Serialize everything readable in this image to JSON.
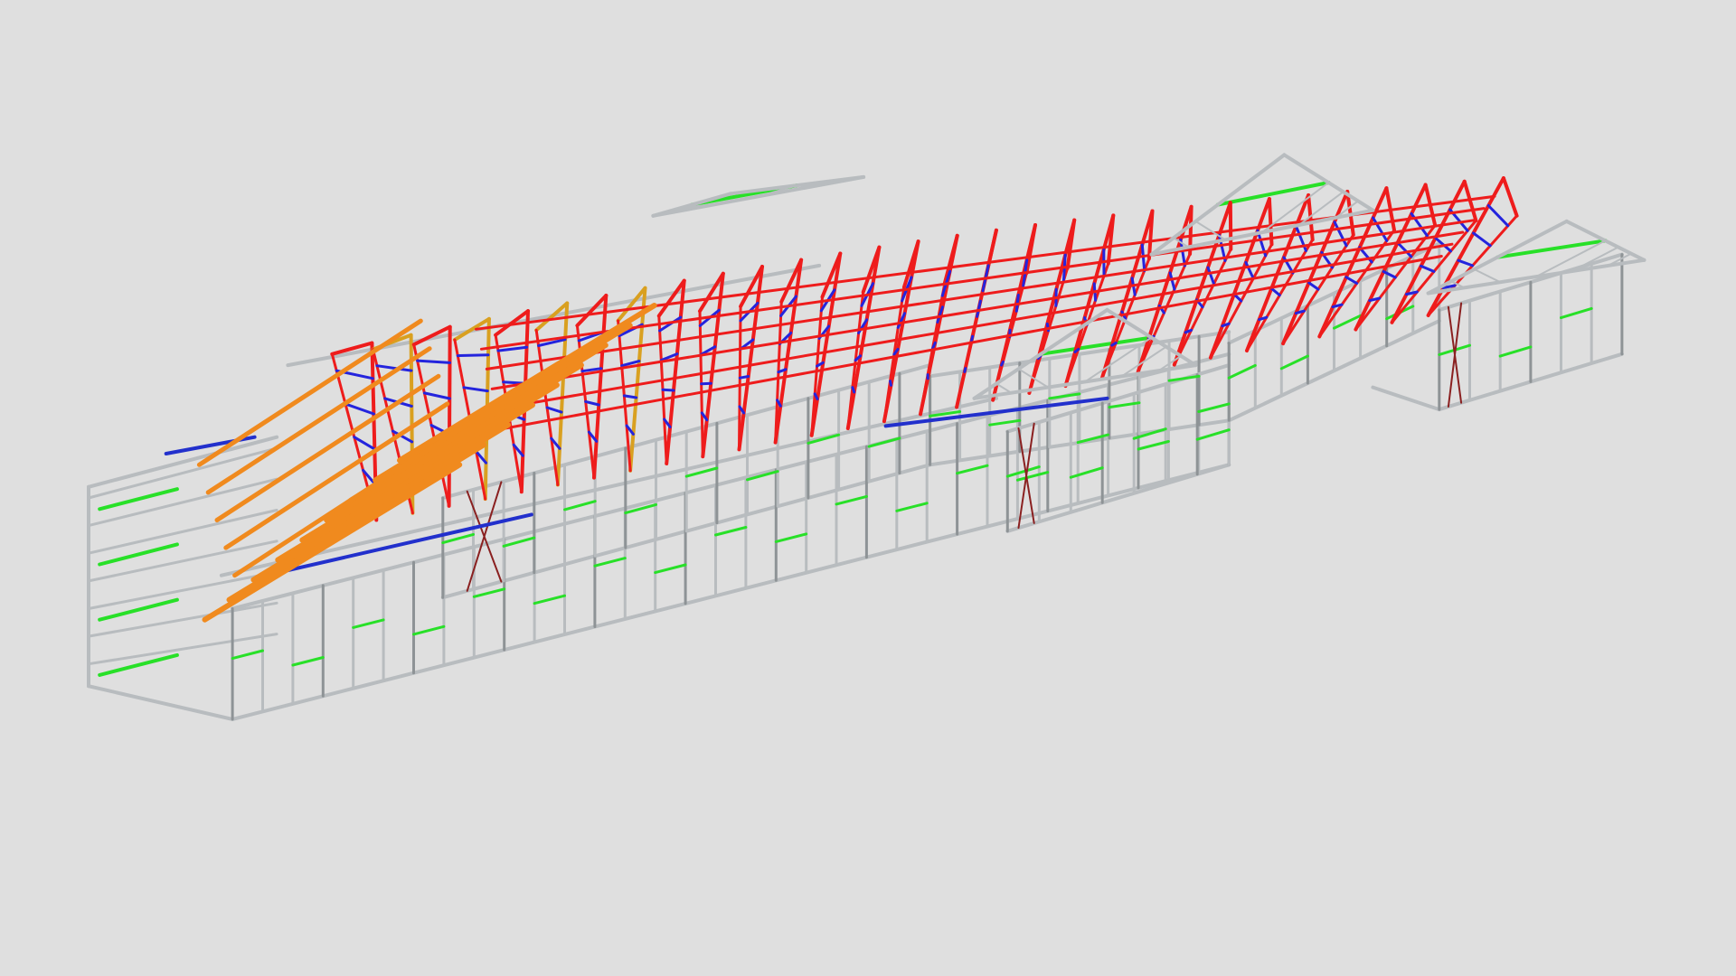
{
  "scene": {
    "subject": "steel-frame-house-3d-model",
    "background_color": "#dfdfdf",
    "colors": {
      "wall_frame": "#b8bcbf",
      "wall_frame_dark": "#8e9396",
      "noggin": "#28e028",
      "truss_chord": "#ee1c1c",
      "truss_web": "#2424dd",
      "rafter": "#f08a1e",
      "gold_truss": "#d9a020",
      "brace": "#8a2020",
      "lintel": "#2230cc"
    }
  }
}
